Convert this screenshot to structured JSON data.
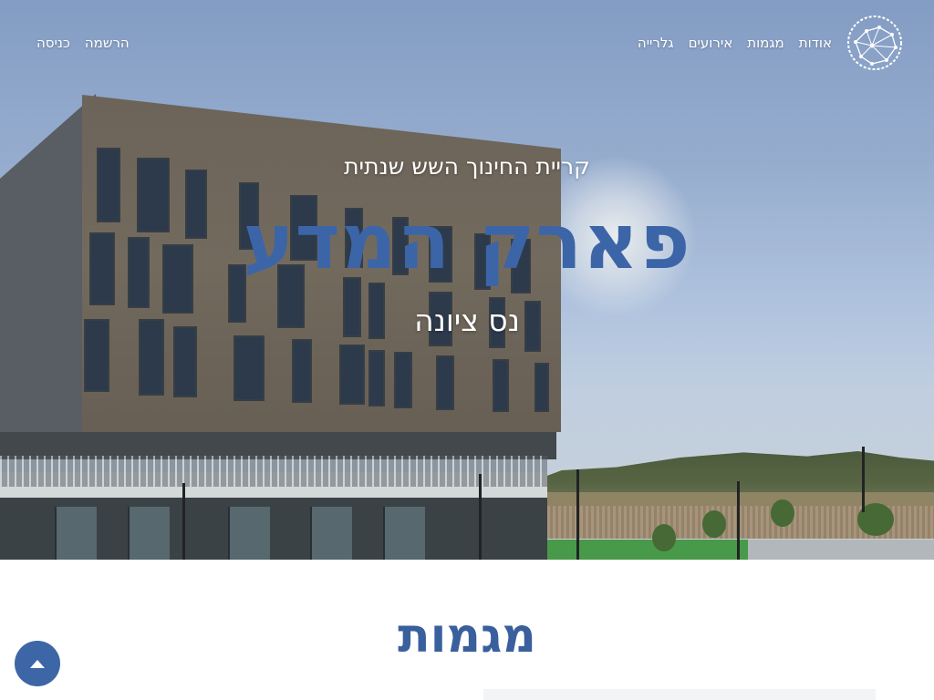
{
  "nav": {
    "logo_icon": "globe-network-icon",
    "items": [
      {
        "label": "אודות"
      },
      {
        "label": "מגמות"
      },
      {
        "label": "אירועים"
      },
      {
        "label": "גלרייה"
      }
    ],
    "auth": {
      "register_label": "הרשמה",
      "login_label": "כניסה"
    }
  },
  "hero": {
    "kicker": "קריית החינוך השש שנתית",
    "title": "פארק המדע",
    "subtitle": "נס ציונה"
  },
  "section": {
    "title": "מגמות"
  },
  "scroll_top": {
    "icon": "arrow-up-icon"
  },
  "colors": {
    "accent": "#3c65a8",
    "nav_text": "#ffffff"
  }
}
